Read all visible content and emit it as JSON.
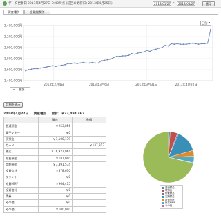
{
  "topbar": {
    "label": "データ更新日",
    "update_text": "2013年4月27日 9:40時点 (前回の更新日) 2013年4月25日)",
    "date_from": "2013/01/27",
    "date_to": "2013/04/27",
    "apply_label": "適用"
  },
  "tabs": [
    {
      "label": "資産種別"
    },
    {
      "label": "金融機関別"
    }
  ],
  "period_select": "日別",
  "chart_data": {
    "type": "line",
    "series": [
      {
        "name": "合計",
        "values": [
          1580000,
          1600000,
          1610000,
          1620000,
          1620000,
          1630000,
          1640000,
          1650000,
          1660000,
          1670000,
          1660000,
          1670000,
          1680000,
          1690000,
          1710000,
          1710000,
          1720000,
          1710000,
          1720000,
          1730000,
          1720000,
          1720000,
          1730000,
          1720000,
          1720000,
          1760000,
          1770000,
          1780000,
          1790000,
          1820000,
          1840000,
          1840000,
          1850000,
          1850000,
          1860000,
          1890000,
          1880000,
          1900000,
          1910000,
          1920000,
          1950000,
          1930000,
          1960000,
          1970000,
          1990000,
          2000000,
          2040000,
          2030000,
          2070000,
          2060000,
          2070000,
          2060000,
          2060000,
          2060000,
          2070000,
          2080000,
          2070000,
          2060000,
          2070000,
          2070000,
          2080000,
          2330000
        ]
      }
    ],
    "y_ticks": [
      "2,400,000円",
      "2,200,000円",
      "2,000,000円",
      "1,800,000円",
      "1,600,000円",
      "1,400,000円"
    ],
    "ylim": [
      1400000,
      2400000
    ],
    "x_ticks": [
      "2013年2月4日",
      "2013年3月6日",
      "2013年3月31日",
      "2013年4月20日"
    ],
    "legend_label": "合計",
    "line_color": "#6b87b8",
    "grid": true
  },
  "detail_button": "詳細を表示",
  "date_header": {
    "date": "2013年4月27日",
    "kind": "資産種別",
    "total": "合計：￥33,494,467"
  },
  "table": {
    "headers": [
      "",
      "資産",
      "負債"
    ],
    "rows": [
      {
        "label": "普通預金",
        "asset": "￥253,856",
        "debt": ""
      },
      {
        "label": "電子マネー",
        "asset": "￥0",
        "debt": ""
      },
      {
        "label": "現預金",
        "asset": "￥1,100,179",
        "debt": ""
      },
      {
        "label": "カード",
        "asset": "",
        "debt": "￥147,313"
      },
      {
        "label": "株式",
        "asset": "￥16,927,964",
        "debt": ""
      },
      {
        "label": "貯蓄預金",
        "asset": "￥181,000",
        "debt": ""
      },
      {
        "label": "定期預金",
        "asset": "￥3,391,574",
        "debt": ""
      },
      {
        "label": "投資信託",
        "asset": "￥878,610",
        "debt": ""
      },
      {
        "label": "ワラント",
        "asset": "￥0",
        "debt": ""
      },
      {
        "label": "外貨MMF",
        "asset": "￥964,415",
        "debt": ""
      },
      {
        "label": "投資信託",
        "asset": "￥0",
        "debt": ""
      },
      {
        "label": "債券",
        "asset": "￥0",
        "debt": ""
      },
      {
        "label": "その他",
        "asset": "￥0",
        "debt": ""
      },
      {
        "label": "その他",
        "asset": "￥100,000",
        "debt": ""
      }
    ]
  },
  "pie": {
    "slices": [
      {
        "label": "普通預金",
        "value": 253856,
        "color": "#5b7fc0"
      },
      {
        "label": "現預金",
        "value": 1100179,
        "color": "#c0504d"
      },
      {
        "label": "貯蓄預金",
        "value": 181000,
        "color": "#8064a2"
      },
      {
        "label": "定期預金",
        "value": 3391574,
        "color": "#3a8fb7"
      },
      {
        "label": "投資信託",
        "value": 878610,
        "color": "#e08a2e"
      },
      {
        "label": "外貨MMF",
        "value": 964415,
        "color": "#4bacc6"
      },
      {
        "label": "その他",
        "value": 100000,
        "color": "#c46aa6"
      },
      {
        "label": "株式",
        "value": 16927964,
        "color": "#9bbb59"
      }
    ],
    "legend": [
      {
        "label": "普通預金",
        "color": "#5b7fc0"
      },
      {
        "label": "現預金",
        "color": "#c0504d"
      },
      {
        "label": "貯蓄預金",
        "color": "#8064a2"
      },
      {
        "label": "定期預金",
        "color": "#3a8fb7"
      },
      {
        "label": "投資信託",
        "color": "#e08a2e"
      },
      {
        "label": "外貨MMF",
        "color": "#4bacc6"
      },
      {
        "label": "その他",
        "color": "#c46aa6"
      }
    ]
  }
}
